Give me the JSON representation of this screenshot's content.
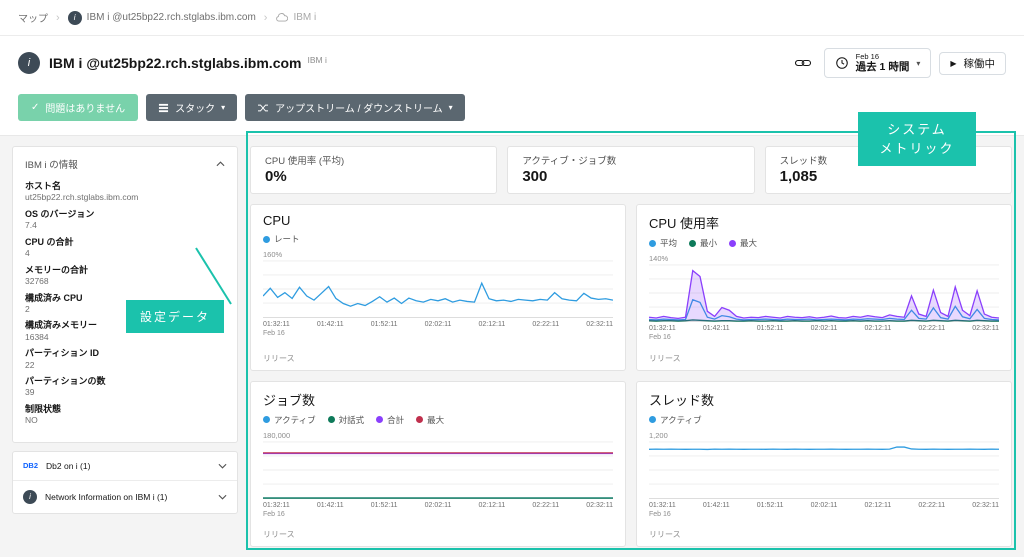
{
  "accent": {
    "teal": "#1bc2ac",
    "green_pill": "#79d2ab",
    "dark_button": "#5b6770",
    "blue": "#2f9ce0",
    "purple": "#8a3ffc",
    "dark_green": "#0e7a5a",
    "red": "#c0304d"
  },
  "glyphs": {
    "caret_down": "▾",
    "check": "✓",
    "play": "▶",
    "sep": "›",
    "ibmi_letter": "i"
  },
  "breadcrumb": {
    "items": [
      "マップ",
      "IBM i @ut25bp22.rch.stglabs.ibm.com",
      "IBM i"
    ]
  },
  "header": {
    "title": "IBM i @ut25bp22.rch.stglabs.ibm.com",
    "type_label": "IBM i",
    "time_range": {
      "date": "Feb 16",
      "label": "過去 1 時間"
    },
    "status_button": "稼働中"
  },
  "toolbar": {
    "no_issues": "問題はありません",
    "stack": "スタック",
    "updown": "アップストリーム / ダウンストリーム"
  },
  "sidebar": {
    "section_title": "IBM i の情報",
    "items": [
      {
        "label": "ホスト名",
        "value": "ut25bp22.rch.stglabs.ibm.com"
      },
      {
        "label": "OS のバージョン",
        "value": "7.4"
      },
      {
        "label": "CPU の合計",
        "value": "4"
      },
      {
        "label": "メモリーの合計",
        "value": "32768"
      },
      {
        "label": "構成済み CPU",
        "value": "2"
      },
      {
        "label": "構成済みメモリー",
        "value": "16384"
      },
      {
        "label": "パーティション ID",
        "value": "22"
      },
      {
        "label": "パーティションの数",
        "value": "39"
      },
      {
        "label": "制限状態",
        "value": "NO"
      }
    ],
    "groups": [
      {
        "icon": "db2-logo",
        "label": "Db2 on i (1)"
      },
      {
        "icon": "ibmi-icon",
        "label": "Network Information on IBM i (1)"
      }
    ]
  },
  "metrics": [
    {
      "label": "CPU 使用率 (平均)",
      "value": "0%"
    },
    {
      "label": "アクティブ・ジョブ数",
      "value": "300"
    },
    {
      "label": "スレッド数",
      "value": "1,085"
    }
  ],
  "annotations": {
    "system_metrics_line1": "システム",
    "system_metrics_line2": "メトリック",
    "config_data": "設定データ"
  },
  "chart_footer": "リリース",
  "x_axis": {
    "ticks": [
      "01:32:11",
      "01:42:11",
      "01:52:11",
      "02:02:11",
      "02:12:11",
      "02:22:11",
      "02:32:11"
    ],
    "first_sub": "Feb 16"
  },
  "chart_data": [
    {
      "type": "line",
      "title": "CPU",
      "ymax_label": "160%",
      "ylim": [
        0,
        160
      ],
      "series": [
        {
          "name": "レート",
          "color": "#2f9ce0",
          "values": [
            62,
            85,
            58,
            72,
            55,
            88,
            62,
            50,
            70,
            90,
            55,
            40,
            32,
            40,
            34,
            46,
            60,
            44,
            56,
            40,
            56,
            48,
            44,
            52,
            48,
            54,
            44,
            50,
            46,
            44,
            100,
            54,
            48,
            50,
            46,
            52,
            50,
            48,
            52,
            50,
            72,
            54,
            50,
            48,
            70,
            56,
            52,
            54,
            50
          ]
        }
      ]
    },
    {
      "type": "line",
      "title": "CPU 使用率",
      "ymax_label": "140%",
      "ylim": [
        0,
        140
      ],
      "series": [
        {
          "name": "平均",
          "color": "#2f9ce0",
          "values": [
            4,
            3,
            5,
            4,
            3,
            4,
            55,
            48,
            10,
            5,
            14,
            11,
            5,
            3,
            4,
            4,
            5,
            4,
            3,
            5,
            4,
            4,
            5,
            3,
            4,
            5,
            4,
            3,
            5,
            4,
            6,
            5,
            4,
            7,
            5,
            4,
            28,
            7,
            5,
            34,
            9,
            5,
            38,
            11,
            6,
            30,
            7,
            4,
            3
          ]
        },
        {
          "name": "最小",
          "color": "#0e7a5a",
          "values": [
            1,
            0,
            1,
            1,
            0,
            1,
            3,
            2,
            1,
            0,
            1,
            1,
            0,
            0,
            1,
            0,
            0,
            1,
            0,
            0,
            1,
            0,
            0,
            1,
            0,
            1,
            0,
            0,
            1,
            0,
            1,
            0,
            0,
            1,
            0,
            0,
            2,
            1,
            0,
            2,
            1,
            0,
            2,
            1,
            0,
            2,
            1,
            0,
            0
          ]
        },
        {
          "name": "最大",
          "color": "#8a3ffc",
          "fill": true,
          "values": [
            10,
            8,
            12,
            9,
            7,
            10,
            130,
            115,
            25,
            12,
            35,
            28,
            12,
            8,
            10,
            9,
            12,
            10,
            8,
            12,
            10,
            9,
            11,
            8,
            10,
            13,
            9,
            8,
            12,
            10,
            14,
            11,
            9,
            16,
            12,
            10,
            65,
            18,
            12,
            80,
            22,
            12,
            88,
            28,
            14,
            78,
            18,
            10,
            8
          ]
        }
      ]
    },
    {
      "type": "line",
      "title": "ジョブ数",
      "ymax_label": "180,000",
      "ylim": [
        0,
        180000
      ],
      "series": [
        {
          "name": "アクティブ",
          "color": "#2f9ce0",
          "values": [
            300,
            300,
            300,
            300,
            300,
            300,
            300,
            300,
            300,
            300,
            300,
            300,
            300
          ]
        },
        {
          "name": "対話式",
          "color": "#0e7a5a",
          "values": [
            90,
            90,
            90,
            90,
            90,
            90,
            90,
            90,
            90,
            90,
            90,
            90,
            90
          ]
        },
        {
          "name": "合計",
          "color": "#8a3ffc",
          "values": [
            148000,
            148000,
            148000,
            148000,
            148000,
            148000,
            148000,
            148000,
            148000,
            148000,
            148000,
            148000,
            148000
          ]
        },
        {
          "name": "最大",
          "color": "#c0304d",
          "values": [
            150000,
            150000,
            150000,
            150000,
            150000,
            150000,
            150000,
            150000,
            150000,
            150000,
            150000,
            150000,
            150000
          ]
        }
      ]
    },
    {
      "type": "line",
      "title": "スレッド数",
      "ymax_label": "1,200",
      "ylim": [
        0,
        1200
      ],
      "series": [
        {
          "name": "アクティブ",
          "color": "#2f9ce0",
          "values": [
            1078,
            1082,
            1079,
            1083,
            1080,
            1077,
            1081,
            1080,
            1076,
            1082,
            1079,
            1083,
            1080,
            1078,
            1081,
            1079,
            1077,
            1082,
            1080,
            1078,
            1083,
            1080,
            1077,
            1081,
            1079,
            1082,
            1080,
            1078,
            1081,
            1080,
            1083,
            1079,
            1077,
            1082,
            1130,
            1128,
            1086,
            1080,
            1078,
            1082,
            1080,
            1077,
            1081,
            1079,
            1083,
            1080,
            1078,
            1082,
            1080
          ]
        }
      ]
    }
  ]
}
